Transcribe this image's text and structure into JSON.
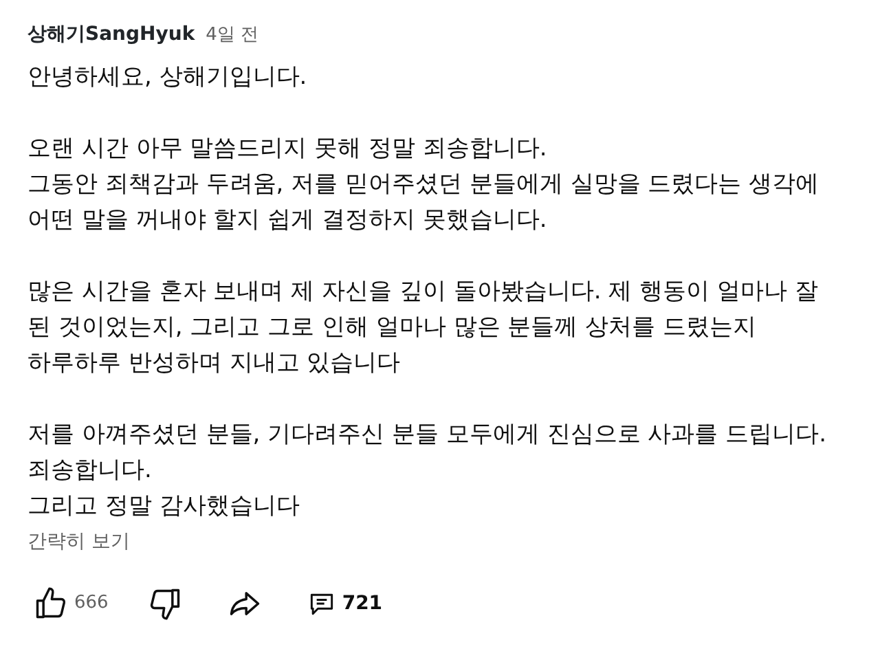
{
  "comment": {
    "author": "상해기SangHyuk",
    "time": "4일 전",
    "paragraphs": [
      [
        "안녕하세요, 상해기입니다."
      ],
      [
        "오랜 시간 아무 말씀드리지 못해 정말 죄송합니다.",
        "그동안 죄책감과 두려움, 저를 믿어주셨던 분들에게 실망을 드렸다는 생각에",
        "어떤 말을 꺼내야 할지 쉽게 결정하지 못했습니다."
      ],
      [
        "많은 시간을 혼자 보내며 제 자신을 깊이 돌아봤습니다. 제 행동이 얼마나 잘",
        "된 것이었는지, 그리고 그로 인해 얼마나 많은 분들께 상처를 드렸는지",
        "하루하루 반성하며 지내고 있습니다"
      ],
      [
        "저를 아껴주셨던 분들, 기다려주신 분들 모두에게 진심으로 사과를 드립니다.",
        "죄송합니다.",
        "그리고 정말 감사했습니다"
      ]
    ],
    "collapse_link": "간략히 보기",
    "likes": "666",
    "replies": "721"
  }
}
